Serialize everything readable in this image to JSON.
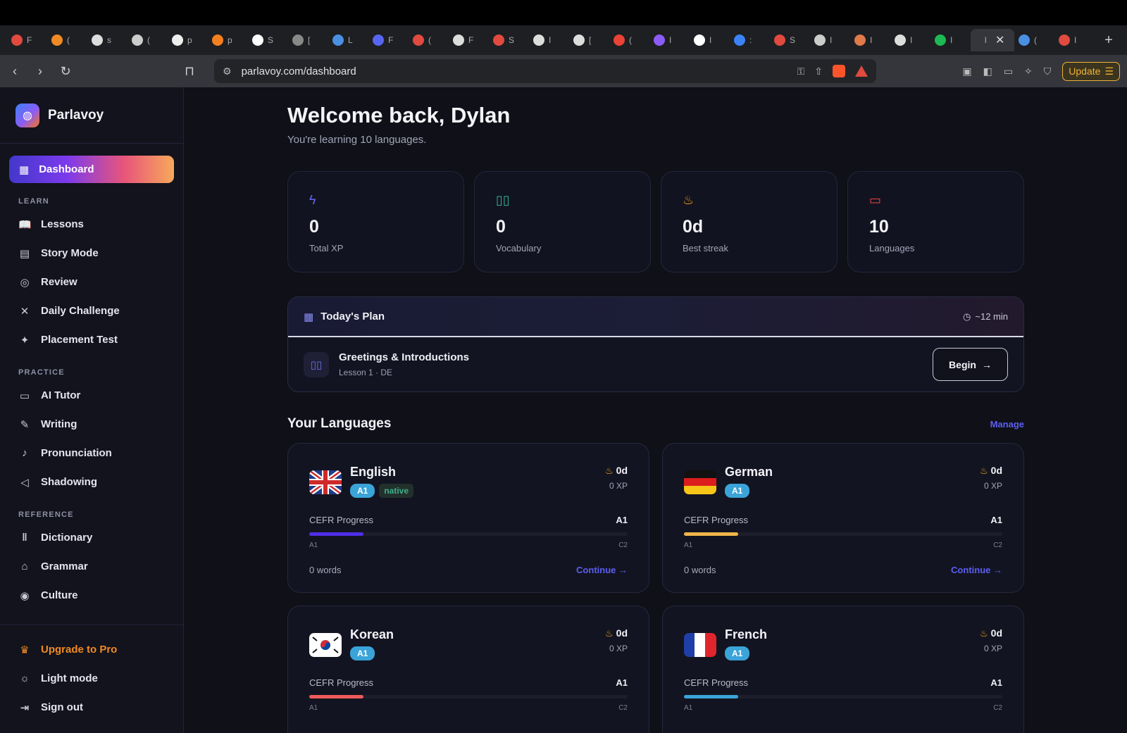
{
  "browser": {
    "tabs": [
      {
        "letter": "F",
        "color": "#e04a3f"
      },
      {
        "letter": "(",
        "color": "#f08a24"
      },
      {
        "letter": "s",
        "color": "#dddddd"
      },
      {
        "letter": "(",
        "color": "#cccccc"
      },
      {
        "letter": "p",
        "color": "#eeeeee"
      },
      {
        "letter": "p",
        "color": "#f38020"
      },
      {
        "letter": "S",
        "color": "#ffffff"
      },
      {
        "letter": "[",
        "color": "#888888"
      },
      {
        "letter": "L",
        "color": "#4a90e2"
      },
      {
        "letter": "F",
        "color": "#5865f2"
      },
      {
        "letter": "(",
        "color": "#e04a3f"
      },
      {
        "letter": "F",
        "color": "#dddddd"
      },
      {
        "letter": "S",
        "color": "#e04a3f"
      },
      {
        "letter": "I",
        "color": "#dddddd"
      },
      {
        "letter": "[",
        "color": "#dddddd"
      },
      {
        "letter": "(",
        "color": "#ea4335"
      },
      {
        "letter": "I",
        "color": "#8b5cf6"
      },
      {
        "letter": "I",
        "color": "#ffffff"
      },
      {
        "letter": ":",
        "color": "#3b82f6"
      },
      {
        "letter": "S",
        "color": "#e04a3f"
      },
      {
        "letter": "I",
        "color": "#cccccc"
      },
      {
        "letter": "I",
        "color": "#e07a4a"
      },
      {
        "letter": "I",
        "color": "#dddddd"
      },
      {
        "letter": "I",
        "color": "#1db954"
      }
    ],
    "active_tab": {
      "letter": "I"
    },
    "after_tabs": [
      {
        "letter": "(",
        "color": "#4a90e2"
      },
      {
        "letter": "I",
        "color": "#e04a3f"
      }
    ],
    "url": "parlavoy.com/dashboard",
    "update_label": "Update"
  },
  "sidebar": {
    "brand": "Parlavoy",
    "active_item": "Dashboard",
    "sections": [
      {
        "label": "LEARN",
        "items": [
          {
            "label": "Lessons",
            "icon": "book-open-icon",
            "glyph": "📖"
          },
          {
            "label": "Story Mode",
            "icon": "bookmark-book-icon",
            "glyph": "▤"
          },
          {
            "label": "Review",
            "icon": "globe-icon",
            "glyph": "◎"
          },
          {
            "label": "Daily Challenge",
            "icon": "swords-icon",
            "glyph": "✕"
          },
          {
            "label": "Placement Test",
            "icon": "sparkles-icon",
            "glyph": "✦"
          }
        ]
      },
      {
        "label": "PRACTICE",
        "items": [
          {
            "label": "AI Tutor",
            "icon": "chat-bubble-icon",
            "glyph": "▭"
          },
          {
            "label": "Writing",
            "icon": "pen-icon",
            "glyph": "✎"
          },
          {
            "label": "Pronunciation",
            "icon": "microphone-icon",
            "glyph": "♪"
          },
          {
            "label": "Shadowing",
            "icon": "speaker-icon",
            "glyph": "◁"
          }
        ]
      },
      {
        "label": "REFERENCE",
        "items": [
          {
            "label": "Dictionary",
            "icon": "library-icon",
            "glyph": "‖"
          },
          {
            "label": "Grammar",
            "icon": "graduation-cap-icon",
            "glyph": "⌂"
          },
          {
            "label": "Culture",
            "icon": "map-pin-icon",
            "glyph": "◉"
          }
        ]
      }
    ],
    "upgrade": "Upgrade to Pro",
    "light_mode": "Light mode",
    "sign_out": "Sign out"
  },
  "main": {
    "welcome": "Welcome back, Dylan",
    "subtitle": "You're learning 10 languages.",
    "stats": [
      {
        "value": "0",
        "label": "Total XP",
        "icon": "lightning-icon",
        "color": "#6366f1"
      },
      {
        "value": "0",
        "label": "Vocabulary",
        "icon": "book-icon",
        "color": "#2fb39a"
      },
      {
        "value": "0d",
        "label": "Best streak",
        "icon": "flame-icon",
        "color": "#f59e0b"
      },
      {
        "value": "10",
        "label": "Languages",
        "icon": "message-icon",
        "color": "#ef4444"
      }
    ],
    "plan": {
      "title": "Today's Plan",
      "time": "~12 min",
      "lesson_title": "Greetings & Introductions",
      "lesson_sub": "Lesson 1 · DE",
      "begin": "Begin"
    },
    "languages_title": "Your Languages",
    "manage": "Manage",
    "cefr_label": "CEFR Progress",
    "bar_start": "A1",
    "bar_end": "C2",
    "continue": "Continue",
    "languages": [
      {
        "name": "English",
        "level": "A1",
        "native": "native",
        "streak": "0d",
        "xp": "0 XP",
        "cefr_level": "A1",
        "progress": 0.17,
        "bar_color": "#4f2ee8",
        "words": "0 words",
        "flag": "uk"
      },
      {
        "name": "German",
        "level": "A1",
        "native": "",
        "streak": "0d",
        "xp": "0 XP",
        "cefr_level": "A1",
        "progress": 0.17,
        "bar_color": "#f0b64a",
        "words": "0 words",
        "flag": "de"
      },
      {
        "name": "Korean",
        "level": "A1",
        "native": "",
        "streak": "0d",
        "xp": "0 XP",
        "cefr_level": "A1",
        "progress": 0.17,
        "bar_color": "#ee5a5a",
        "words": "",
        "flag": "kr"
      },
      {
        "name": "French",
        "level": "A1",
        "native": "",
        "streak": "0d",
        "xp": "0 XP",
        "cefr_level": "A1",
        "progress": 0.17,
        "bar_color": "#3aa4d9",
        "words": "",
        "flag": "fr"
      }
    ]
  }
}
